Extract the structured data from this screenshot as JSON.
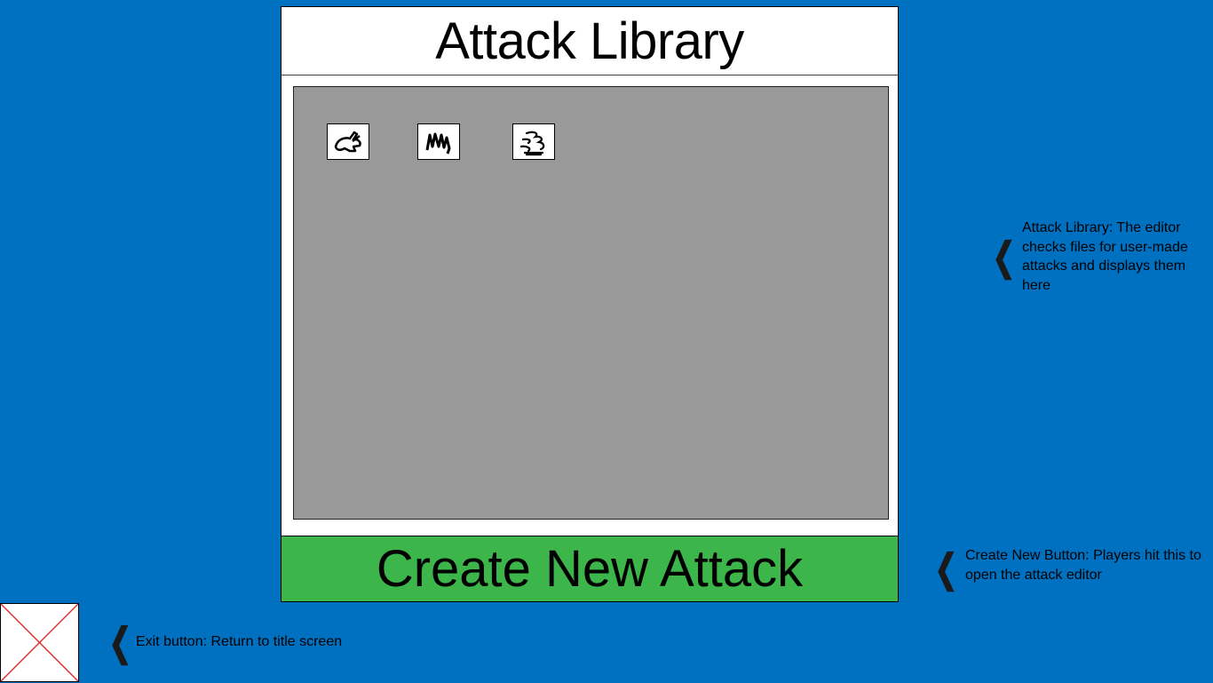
{
  "window": {
    "title": "Attack Library"
  },
  "library": {
    "items": [
      {
        "icon": "rabbit-icon"
      },
      {
        "icon": "claw-scratch-icon"
      },
      {
        "icon": "whirlwind-icon"
      }
    ]
  },
  "create_button": {
    "label": "Create New Attack"
  },
  "exit_button": {
    "icon": "close-x-icon"
  },
  "annotations": {
    "library_note": "Attack Library: The editor checks files for user-made attacks and displays them here",
    "create_note": "Create New Button: Players hit this to open the attack editor",
    "exit_note": "Exit button: Return to title screen",
    "pointer_glyph": "❮"
  },
  "colors": {
    "background": "#0070c0",
    "library_area": "#999999",
    "create_button": "#3cb54a"
  }
}
